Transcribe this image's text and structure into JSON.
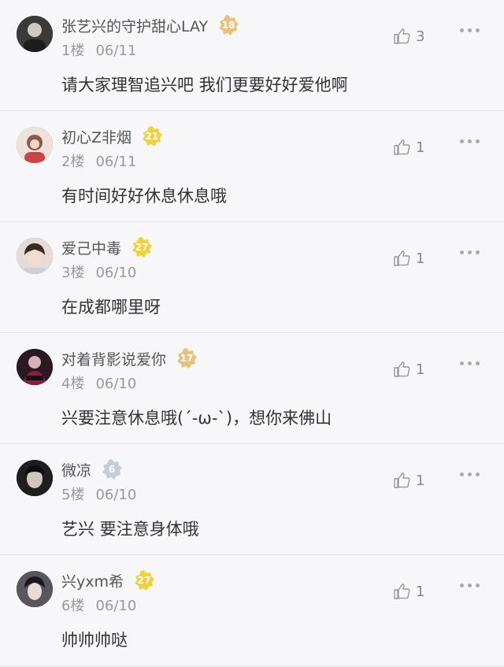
{
  "comments": [
    {
      "username": "张艺兴的守护甜心LAY",
      "level": "18",
      "floor": "1楼",
      "date": "06/11",
      "text": "请大家理智追兴吧  我们更要好好爱他啊",
      "likes": "3",
      "avatar_color": "#3a3a3a",
      "badge_color": "#e8c27a"
    },
    {
      "username": "初心Z非烟",
      "level": "21",
      "floor": "2楼",
      "date": "06/11",
      "text": "有时间好好休息休息哦",
      "likes": "1",
      "avatar_color": "#c9a69a",
      "badge_color": "#f2d23a"
    },
    {
      "username": "爱己中毒",
      "level": "27",
      "floor": "3楼",
      "date": "06/10",
      "text": "在成都哪里呀",
      "likes": "1",
      "avatar_color": "#d8c4bd",
      "badge_color": "#f2d23a"
    },
    {
      "username": "对着背影说爱你",
      "level": "17",
      "floor": "4楼",
      "date": "06/10",
      "text": "兴要注意休息哦(´-ω-`)，想你来佛山",
      "likes": "1",
      "avatar_color": "#4a2b3a",
      "badge_color": "#e8c27a"
    },
    {
      "username": "微凉",
      "level": "6",
      "floor": "5楼",
      "date": "06/10",
      "text": "艺兴 要注意身体哦",
      "likes": "1",
      "avatar_color": "#2b2b2b",
      "badge_color": "#c8ccd6"
    },
    {
      "username": "兴yxm希",
      "level": "27",
      "floor": "6楼",
      "date": "06/10",
      "text": "帅帅帅哒",
      "likes": "1",
      "avatar_color": "#5a5660",
      "badge_color": "#f2d23a"
    }
  ],
  "icons": {
    "like": "thumbs-up-icon",
    "more": "more-dots-icon"
  }
}
